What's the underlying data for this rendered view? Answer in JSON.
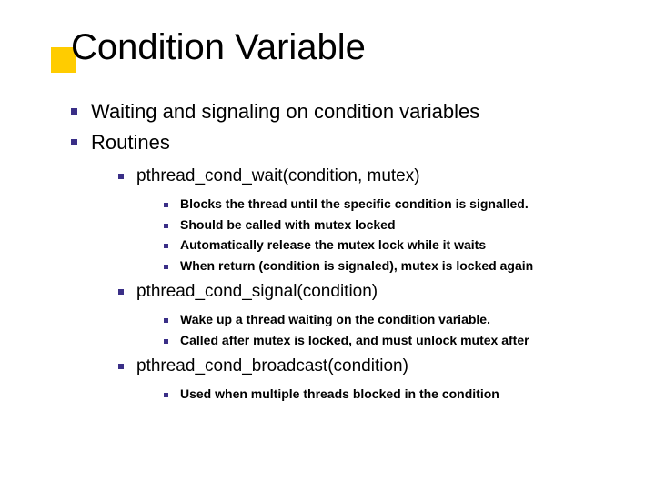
{
  "title": "Condition Variable",
  "level1": [
    "Waiting and signaling on condition variables",
    "Routines"
  ],
  "routines": [
    {
      "name": "pthread_cond_wait(condition, mutex)",
      "details": [
        "Blocks the thread until the specific condition is signalled.",
        "Should be called with mutex locked",
        "Automatically release the mutex lock while it waits",
        "When return (condition is signaled), mutex is locked again"
      ]
    },
    {
      "name": "pthread_cond_signal(condition)",
      "details": [
        "Wake up a thread waiting on the condition variable.",
        "Called after mutex is locked, and must unlock mutex after"
      ]
    },
    {
      "name": "pthread_cond_broadcast(condition)",
      "details": [
        "Used when multiple threads blocked in the condition"
      ]
    }
  ]
}
